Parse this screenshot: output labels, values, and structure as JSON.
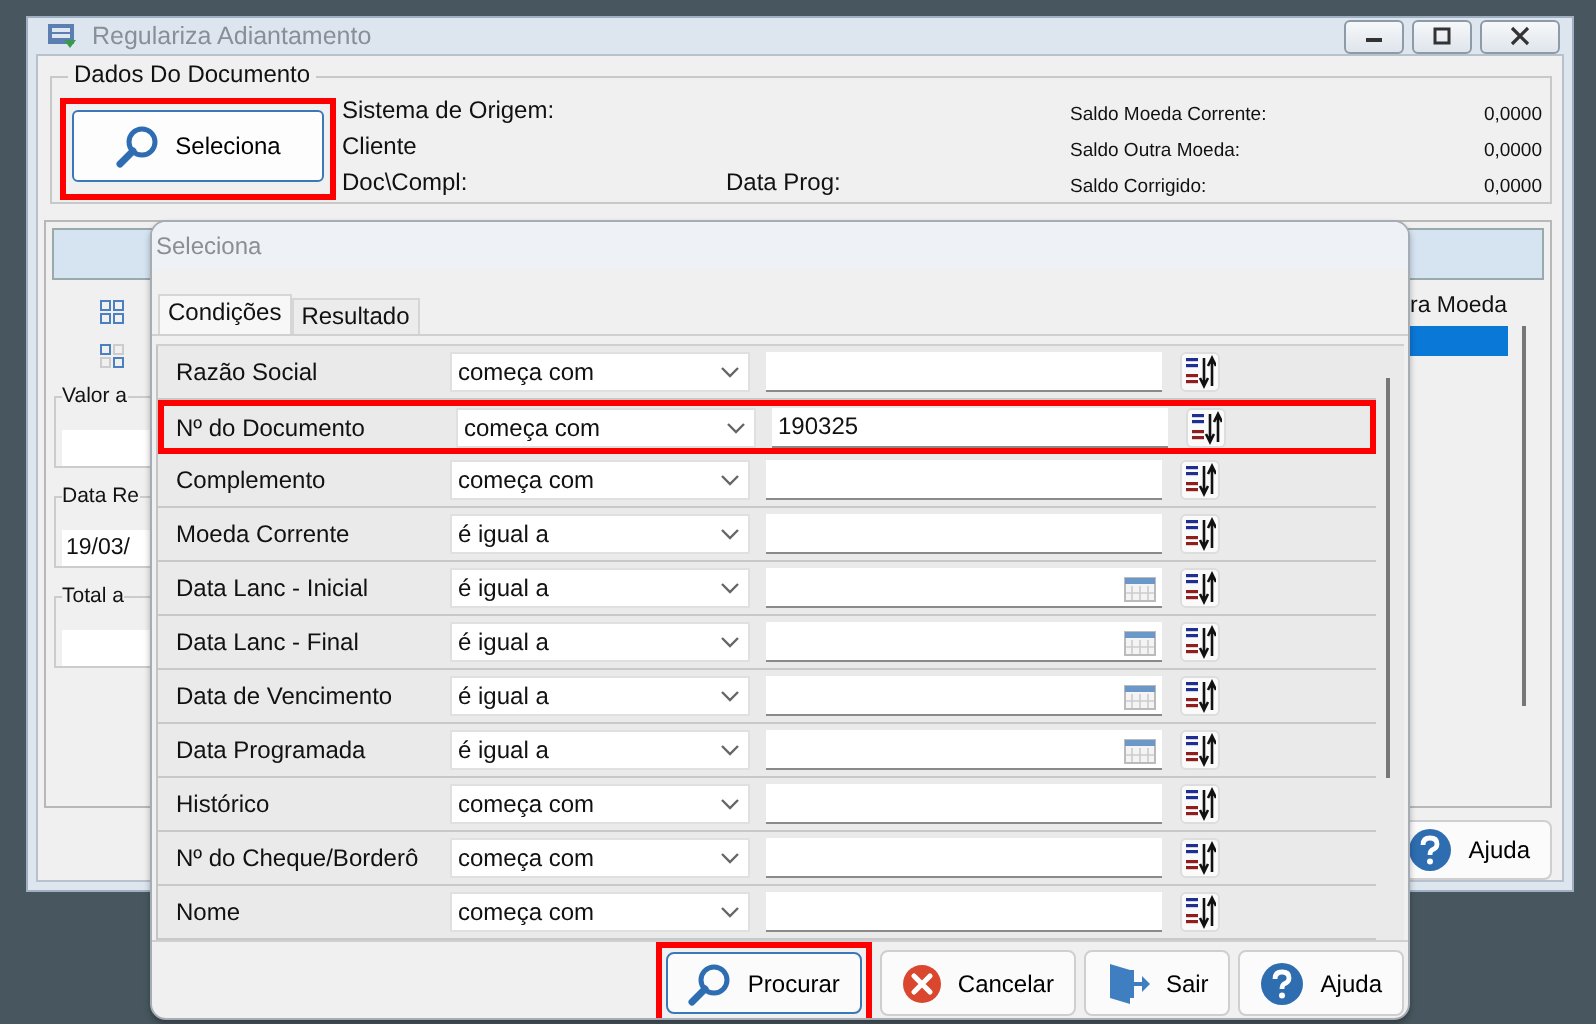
{
  "window": {
    "title": "Regulariza Adiantamento"
  },
  "document_group": {
    "title": "Dados Do Documento",
    "select_button": {
      "label": "Seleciona",
      "highlighted": true
    },
    "fields": [
      {
        "label": "Sistema de Origem:"
      },
      {
        "label": "Cliente"
      },
      {
        "label": "Doc\\Compl:"
      }
    ],
    "schedule_label": "Data Prog:",
    "balances": [
      {
        "label": "Saldo Moeda Corrente:",
        "value": "0,0000"
      },
      {
        "label": "Saldo Outra Moeda:",
        "value": "0,0000"
      },
      {
        "label": "Saldo Corrigido:",
        "value": "0,0000"
      }
    ]
  },
  "lower_panel": {
    "groups": [
      {
        "title": "Valor a"
      },
      {
        "title": "Data Re",
        "value": "19/03/"
      },
      {
        "title": "Total a"
      }
    ],
    "column_header": "ra Moeda",
    "help_button": "Ajuda"
  },
  "dialog": {
    "title": "Seleciona",
    "tabs": [
      {
        "label": "Condições",
        "selected": true
      },
      {
        "label": "Resultado",
        "selected": false
      }
    ],
    "conditions": [
      {
        "label": "Razão Social",
        "operator": "começa com",
        "kind": "text",
        "highlighted": false
      },
      {
        "label": "Nº do Documento",
        "operator": "começa com",
        "value": "190325",
        "kind": "text",
        "highlighted": true
      },
      {
        "label": "Complemento",
        "operator": "começa com",
        "kind": "text",
        "highlighted": false
      },
      {
        "label": "Moeda Corrente",
        "operator": "é igual a",
        "kind": "text",
        "highlighted": false
      },
      {
        "label": "Data Lanc - Inicial",
        "operator": "é igual a",
        "kind": "date",
        "highlighted": false
      },
      {
        "label": "Data Lanc - Final",
        "operator": "é igual a",
        "kind": "date",
        "highlighted": false
      },
      {
        "label": "Data de Vencimento",
        "operator": "é igual a",
        "kind": "date",
        "highlighted": false
      },
      {
        "label": "Data Programada",
        "operator": "é igual a",
        "kind": "date",
        "highlighted": false
      },
      {
        "label": "Histórico",
        "operator": "começa com",
        "kind": "text",
        "highlighted": false
      },
      {
        "label": "Nº do Cheque/Borderô",
        "operator": "começa com",
        "kind": "text",
        "highlighted": false
      },
      {
        "label": "Nome",
        "operator": "começa com",
        "kind": "text",
        "highlighted": false
      }
    ],
    "buttons": [
      {
        "label": "Procurar",
        "kind": "search",
        "highlighted": true
      },
      {
        "label": "Cancelar",
        "kind": "cancel",
        "highlighted": false
      },
      {
        "label": "Sair",
        "kind": "exit",
        "highlighted": false
      },
      {
        "label": "Ajuda",
        "kind": "help",
        "highlighted": false
      }
    ]
  }
}
